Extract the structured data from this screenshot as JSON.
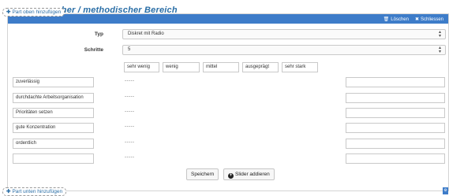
{
  "top_part_button": {
    "icon": "plus-icon",
    "label": "Part oben hinzufügen"
  },
  "bottom_part_button": {
    "icon": "plus-icon",
    "label": "Part unten hinzufügen"
  },
  "section_heading_partial": "...her / methodischer Bereich",
  "panel_header": {
    "delete": {
      "icon": "trash-icon",
      "label": "Löschen"
    },
    "close": {
      "icon": "close-icon",
      "label": "Schliessen"
    },
    "color": "#3d7cc9"
  },
  "form": {
    "type_label": "Typ",
    "type_value": "Diskret mit Radio",
    "steps_label": "Schritte",
    "steps_value": "5"
  },
  "scale_labels": [
    "sehr wenig",
    "wenig",
    "mittel",
    "ausgeprägt",
    "sehr stark"
  ],
  "rows": [
    {
      "left": "zuverlässig",
      "dots": "-----",
      "right": ""
    },
    {
      "left": "durchdachte Arbeitsorganisation",
      "dots": "-----",
      "right": ""
    },
    {
      "left": "Prioritäten setzen",
      "dots": "-----",
      "right": ""
    },
    {
      "left": "gute Konzentration",
      "dots": "-----",
      "right": ""
    },
    {
      "left": "ordentlich",
      "dots": "-----",
      "right": ""
    },
    {
      "left": "",
      "dots": "-----",
      "right": ""
    }
  ],
  "buttons": {
    "save": "Speichern",
    "add_slider": {
      "icon": "plus-circle-icon",
      "label": "Slider addieren"
    }
  }
}
